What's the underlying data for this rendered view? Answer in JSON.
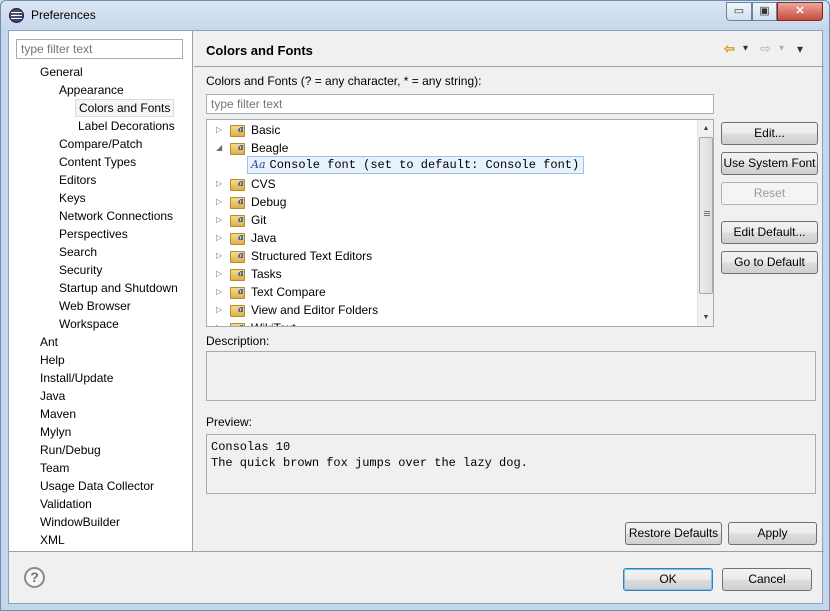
{
  "window": {
    "title": "Preferences",
    "min_glyph": "▭",
    "max_glyph": "▣",
    "close_glyph": "✕"
  },
  "left": {
    "filter_placeholder": "type filter text",
    "tree": [
      {
        "label": "General",
        "level": 1
      },
      {
        "label": "Appearance",
        "level": 2
      },
      {
        "label": "Colors and Fonts",
        "level": 3,
        "selected": true
      },
      {
        "label": "Label Decorations",
        "level": 3
      },
      {
        "label": "Compare/Patch",
        "level": 2
      },
      {
        "label": "Content Types",
        "level": 2
      },
      {
        "label": "Editors",
        "level": 2
      },
      {
        "label": "Keys",
        "level": 2
      },
      {
        "label": "Network Connections",
        "level": 2
      },
      {
        "label": "Perspectives",
        "level": 2
      },
      {
        "label": "Search",
        "level": 2
      },
      {
        "label": "Security",
        "level": 2
      },
      {
        "label": "Startup and Shutdown",
        "level": 2
      },
      {
        "label": "Web Browser",
        "level": 2
      },
      {
        "label": "Workspace",
        "level": 2
      },
      {
        "label": "Ant",
        "level": 1
      },
      {
        "label": "Help",
        "level": 1
      },
      {
        "label": "Install/Update",
        "level": 1
      },
      {
        "label": "Java",
        "level": 1
      },
      {
        "label": "Maven",
        "level": 1
      },
      {
        "label": "Mylyn",
        "level": 1
      },
      {
        "label": "Run/Debug",
        "level": 1
      },
      {
        "label": "Team",
        "level": 1
      },
      {
        "label": "Usage Data Collector",
        "level": 1
      },
      {
        "label": "Validation",
        "level": 1
      },
      {
        "label": "WindowBuilder",
        "level": 1
      },
      {
        "label": "XML",
        "level": 1
      }
    ]
  },
  "page": {
    "title": "Colors and Fonts",
    "nav": {
      "back": "⇦",
      "back_menu": "▾",
      "forward": "⇨",
      "forward_menu": "▾",
      "view_menu": "▾"
    },
    "filter_label": "Colors and Fonts (? = any character, * = any string):",
    "filter_placeholder": "type filter text",
    "tree": [
      {
        "label": "Basic",
        "expanded": false
      },
      {
        "label": "Beagle",
        "expanded": true
      },
      {
        "label": "CVS",
        "expanded": false
      },
      {
        "label": "Debug",
        "expanded": false
      },
      {
        "label": "Git",
        "expanded": false
      },
      {
        "label": "Java",
        "expanded": false
      },
      {
        "label": "Structured Text Editors",
        "expanded": false
      },
      {
        "label": "Tasks",
        "expanded": false
      },
      {
        "label": "Text Compare",
        "expanded": false
      },
      {
        "label": "View and Editor Folders",
        "expanded": false
      },
      {
        "label": "WikiText",
        "expanded": false
      }
    ],
    "selected_font": {
      "icon_text": "Aa",
      "label": "Console font (set to default: Console font)"
    },
    "buttons": {
      "edit": "Edit...",
      "use_system_font": "Use System Font",
      "reset": "Reset",
      "edit_default": "Edit Default...",
      "go_to_default": "Go to Default"
    },
    "description_label": "Description:",
    "preview_label": "Preview:",
    "preview_lines": [
      "Consolas 10",
      "The quick brown fox jumps over the lazy dog."
    ],
    "restore_defaults": "Restore Defaults",
    "apply": "Apply"
  },
  "footer": {
    "help_glyph": "?",
    "ok": "OK",
    "cancel": "Cancel"
  }
}
